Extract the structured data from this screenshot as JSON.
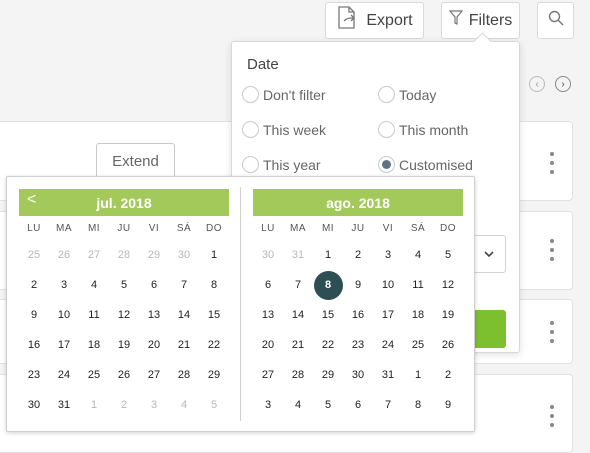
{
  "toolbar": {
    "export_label": "Export",
    "filters_label": "Filters"
  },
  "list": {
    "extend_label": "Extend"
  },
  "filter_panel": {
    "title": "Date",
    "options": [
      "Don't filter",
      "Today",
      "This week",
      "This month",
      "This year",
      "Customised"
    ],
    "selected": "Customised"
  },
  "calendar": {
    "prev_symbol": "<",
    "weekdays": [
      "LU",
      "MA",
      "MI",
      "JU",
      "VI",
      "SÁ",
      "DO"
    ],
    "months": [
      {
        "title": "jul. 2018",
        "days": [
          "25",
          "26",
          "27",
          "28",
          "29",
          "30",
          "1",
          "2",
          "3",
          "4",
          "5",
          "6",
          "7",
          "8",
          "9",
          "10",
          "11",
          "12",
          "13",
          "14",
          "15",
          "16",
          "17",
          "18",
          "19",
          "20",
          "21",
          "22",
          "23",
          "24",
          "25",
          "26",
          "27",
          "28",
          "29",
          "30",
          "31",
          "1",
          "2",
          "3",
          "4",
          "5"
        ],
        "muted": [
          0,
          1,
          2,
          3,
          4,
          5,
          37,
          38,
          39,
          40,
          41
        ]
      },
      {
        "title": "ago. 2018",
        "days": [
          "30",
          "31",
          "1",
          "2",
          "3",
          "4",
          "5",
          "6",
          "7",
          "8",
          "9",
          "10",
          "11",
          "12",
          "13",
          "14",
          "15",
          "16",
          "17",
          "18",
          "19",
          "20",
          "21",
          "22",
          "23",
          "24",
          "25",
          "26",
          "27",
          "28",
          "29",
          "30",
          "31",
          "1",
          "2",
          "3",
          "4",
          "5",
          "6",
          "7",
          "8",
          "9"
        ],
        "muted": [
          0,
          1
        ],
        "selected_index": 9
      }
    ]
  }
}
